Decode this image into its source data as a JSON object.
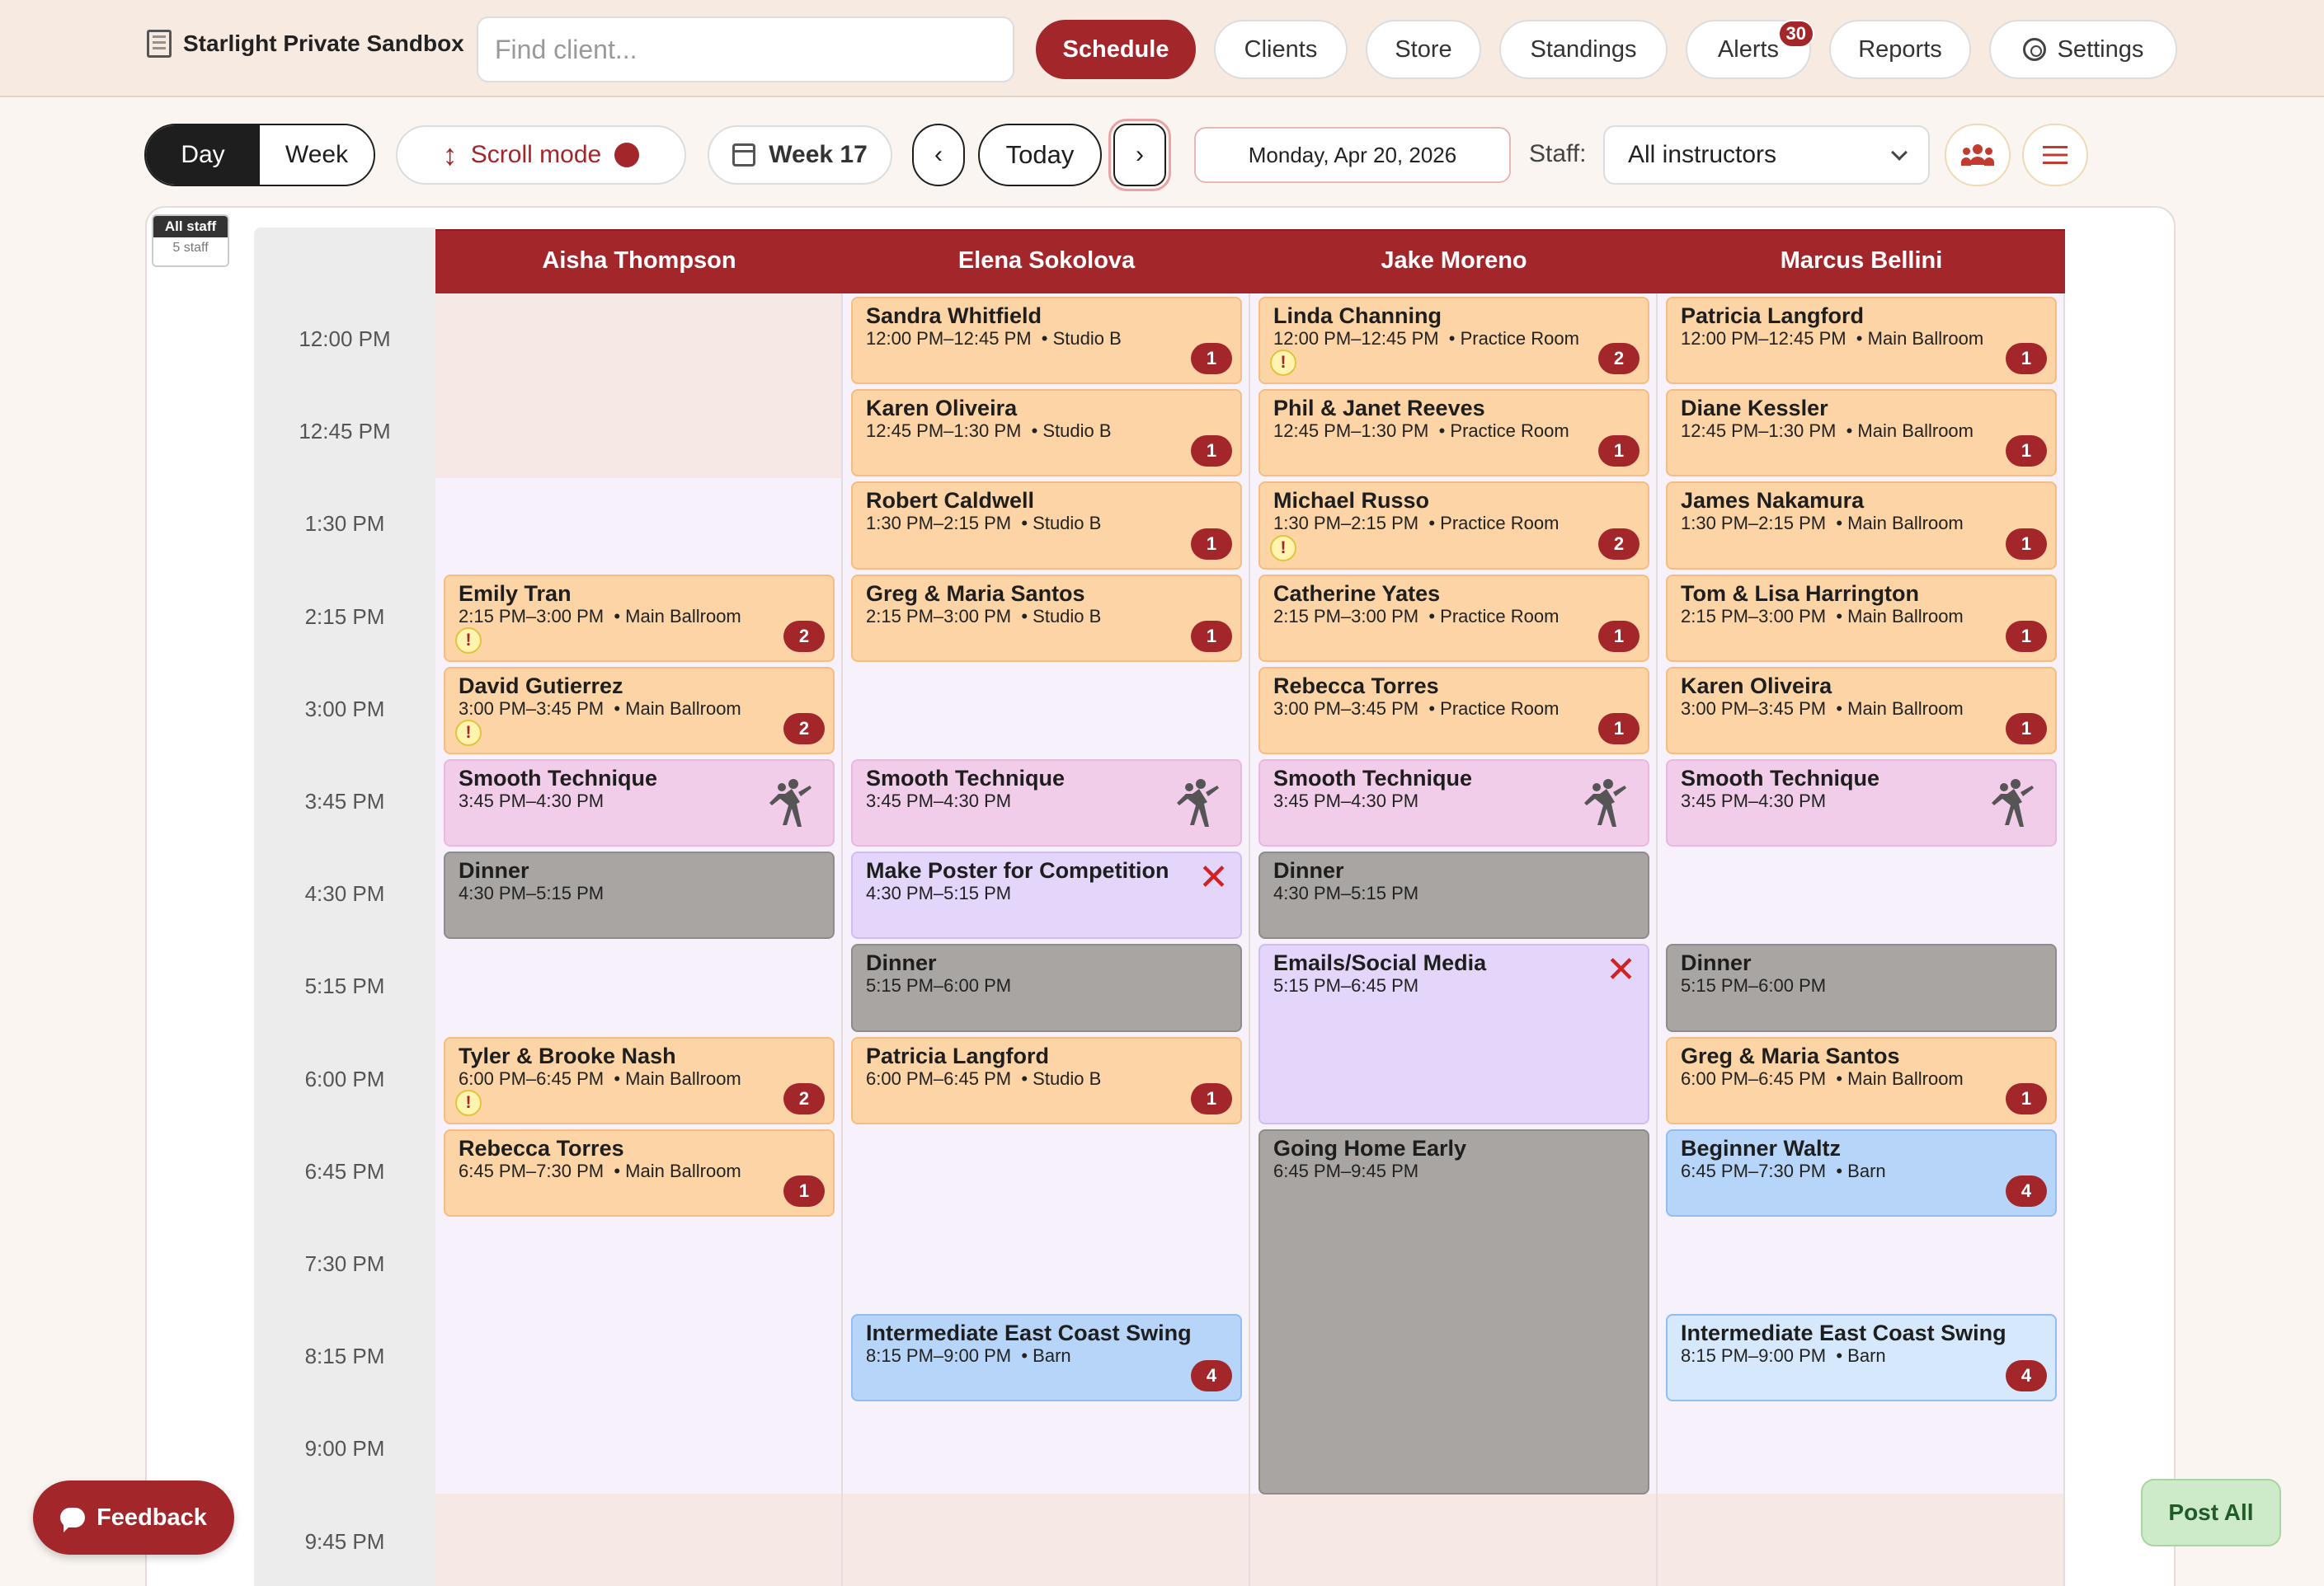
{
  "topbar": {
    "brand": "Starlight Private Sandbox",
    "search_placeholder": "Find client...",
    "nav": [
      {
        "label": "Schedule",
        "active": true
      },
      {
        "label": "Clients"
      },
      {
        "label": "Store"
      },
      {
        "label": "Standings"
      },
      {
        "label": "Alerts",
        "badge": "30"
      },
      {
        "label": "Reports"
      },
      {
        "label": "Settings",
        "icon": "gear-icon"
      }
    ]
  },
  "toolbar": {
    "view_day": "Day",
    "view_week": "Week",
    "scroll_mode": "Scroll mode",
    "week": "Week 17",
    "prev": "‹",
    "today": "Today",
    "next": "›",
    "date": "Monday, Apr 20, 2026",
    "staff_label": "Staff:",
    "staff_selected": "All instructors"
  },
  "all_staff": {
    "title": "All staff",
    "count": "5 staff"
  },
  "times": [
    "12:00 PM",
    "12:45 PM",
    "1:30 PM",
    "2:15 PM",
    "3:00 PM",
    "3:45 PM",
    "4:30 PM",
    "5:15 PM",
    "6:00 PM",
    "6:45 PM",
    "7:30 PM",
    "8:15 PM",
    "9:00 PM",
    "9:45 PM"
  ],
  "instructors": [
    {
      "name": "Aisha Thompson",
      "events": [
        {
          "title": "Emily Tran",
          "time": "2:15 PM–3:00 PM",
          "room": "Main Ballroom",
          "type": "lesson",
          "start": 3,
          "slots": 1,
          "badge": "2",
          "warn": true
        },
        {
          "title": "David Gutierrez",
          "time": "3:00 PM–3:45 PM",
          "room": "Main Ballroom",
          "type": "lesson",
          "start": 4,
          "slots": 1,
          "badge": "2",
          "warn": true
        },
        {
          "title": "Smooth Technique",
          "time": "3:45 PM–4:30 PM",
          "type": "group",
          "start": 5,
          "slots": 1,
          "dancer": true
        },
        {
          "title": "Dinner",
          "time": "4:30 PM–5:15 PM",
          "type": "block",
          "start": 6,
          "slots": 1
        },
        {
          "title": "Tyler & Brooke Nash",
          "time": "6:00 PM–6:45 PM",
          "room": "Main Ballroom",
          "type": "lesson",
          "start": 8,
          "slots": 1,
          "badge": "2",
          "warn": true
        },
        {
          "title": "Rebecca Torres",
          "time": "6:45 PM–7:30 PM",
          "room": "Main Ballroom",
          "type": "lesson",
          "start": 9,
          "slots": 1,
          "badge": "1"
        }
      ]
    },
    {
      "name": "Elena Sokolova",
      "events": [
        {
          "title": "Sandra Whitfield",
          "time": "12:00 PM–12:45 PM",
          "room": "Studio B",
          "type": "lesson",
          "start": 0,
          "slots": 1,
          "badge": "1"
        },
        {
          "title": "Karen Oliveira",
          "time": "12:45 PM–1:30 PM",
          "room": "Studio B",
          "type": "lesson",
          "start": 1,
          "slots": 1,
          "badge": "1"
        },
        {
          "title": "Robert Caldwell",
          "time": "1:30 PM–2:15 PM",
          "room": "Studio B",
          "type": "lesson",
          "start": 2,
          "slots": 1,
          "badge": "1"
        },
        {
          "title": "Greg & Maria Santos",
          "time": "2:15 PM–3:00 PM",
          "room": "Studio B",
          "type": "lesson",
          "start": 3,
          "slots": 1,
          "badge": "1"
        },
        {
          "title": "Smooth Technique",
          "time": "3:45 PM–4:30 PM",
          "type": "group",
          "start": 5,
          "slots": 1,
          "dancer": true
        },
        {
          "title": "Make Poster for Competition",
          "time": "4:30 PM–5:15 PM",
          "type": "task",
          "start": 6,
          "slots": 1,
          "x": true
        },
        {
          "title": "Dinner",
          "time": "5:15 PM–6:00 PM",
          "type": "block",
          "start": 7,
          "slots": 1
        },
        {
          "title": "Patricia Langford",
          "time": "6:00 PM–6:45 PM",
          "room": "Studio B",
          "type": "lesson",
          "start": 8,
          "slots": 1,
          "badge": "1"
        },
        {
          "title": "Intermediate East Coast Swing",
          "time": "8:15 PM–9:00 PM",
          "room": "Barn",
          "type": "class",
          "start": 11,
          "slots": 1,
          "badge": "4"
        }
      ]
    },
    {
      "name": "Jake Moreno",
      "events": [
        {
          "title": "Linda Channing",
          "time": "12:00 PM–12:45 PM",
          "room": "Practice Room",
          "type": "lesson",
          "start": 0,
          "slots": 1,
          "badge": "2",
          "warn": true
        },
        {
          "title": "Phil & Janet Reeves",
          "time": "12:45 PM–1:30 PM",
          "room": "Practice Room",
          "type": "lesson",
          "start": 1,
          "slots": 1,
          "badge": "1"
        },
        {
          "title": "Michael Russo",
          "time": "1:30 PM–2:15 PM",
          "room": "Practice Room",
          "type": "lesson",
          "start": 2,
          "slots": 1,
          "badge": "2",
          "warn": true
        },
        {
          "title": "Catherine Yates",
          "time": "2:15 PM–3:00 PM",
          "room": "Practice Room",
          "type": "lesson",
          "start": 3,
          "slots": 1,
          "badge": "1"
        },
        {
          "title": "Rebecca Torres",
          "time": "3:00 PM–3:45 PM",
          "room": "Practice Room",
          "type": "lesson",
          "start": 4,
          "slots": 1,
          "badge": "1"
        },
        {
          "title": "Smooth Technique",
          "time": "3:45 PM–4:30 PM",
          "type": "group",
          "start": 5,
          "slots": 1,
          "dancer": true
        },
        {
          "title": "Dinner",
          "time": "4:30 PM–5:15 PM",
          "type": "block",
          "start": 6,
          "slots": 1
        },
        {
          "title": "Emails/Social Media",
          "time": "5:15 PM–6:45 PM",
          "type": "task",
          "start": 7,
          "slots": 2,
          "x": true
        },
        {
          "title": "Going Home Early",
          "time": "6:45 PM–9:45 PM",
          "type": "block",
          "start": 9,
          "slots": 4
        }
      ]
    },
    {
      "name": "Marcus Bellini",
      "events": [
        {
          "title": "Patricia Langford",
          "time": "12:00 PM–12:45 PM",
          "room": "Main Ballroom",
          "type": "lesson",
          "start": 0,
          "slots": 1,
          "badge": "1"
        },
        {
          "title": "Diane Kessler",
          "time": "12:45 PM–1:30 PM",
          "room": "Main Ballroom",
          "type": "lesson",
          "start": 1,
          "slots": 1,
          "badge": "1"
        },
        {
          "title": "James Nakamura",
          "time": "1:30 PM–2:15 PM",
          "room": "Main Ballroom",
          "type": "lesson",
          "start": 2,
          "slots": 1,
          "badge": "1"
        },
        {
          "title": "Tom & Lisa Harrington",
          "time": "2:15 PM–3:00 PM",
          "room": "Main Ballroom",
          "type": "lesson",
          "start": 3,
          "slots": 1,
          "badge": "1"
        },
        {
          "title": "Karen Oliveira",
          "time": "3:00 PM–3:45 PM",
          "room": "Main Ballroom",
          "type": "lesson",
          "start": 4,
          "slots": 1,
          "badge": "1"
        },
        {
          "title": "Smooth Technique",
          "time": "3:45 PM–4:30 PM",
          "type": "group",
          "start": 5,
          "slots": 1,
          "dancer": true
        },
        {
          "title": "Dinner",
          "time": "5:15 PM–6:00 PM",
          "type": "block",
          "start": 7,
          "slots": 1
        },
        {
          "title": "Greg & Maria Santos",
          "time": "6:00 PM–6:45 PM",
          "room": "Main Ballroom",
          "type": "lesson",
          "start": 8,
          "slots": 1,
          "badge": "1"
        },
        {
          "title": "Beginner Waltz",
          "time": "6:45 PM–7:30 PM",
          "room": "Barn",
          "type": "class",
          "start": 9,
          "slots": 1,
          "badge": "4"
        },
        {
          "title": "Intermediate East Coast Swing",
          "time": "8:15 PM–9:00 PM",
          "room": "Barn",
          "type": "class light",
          "start": 11,
          "slots": 1,
          "badge": "4"
        }
      ]
    }
  ],
  "colors": {
    "brand": "#a3262b",
    "lesson": "#fcd4a5",
    "group": "#f2cde9",
    "block": "#a9a5a2",
    "task": "#e4d6fb",
    "class": "#b6d5f9"
  },
  "floating": {
    "feedback": "Feedback",
    "post_all": "Post All"
  }
}
